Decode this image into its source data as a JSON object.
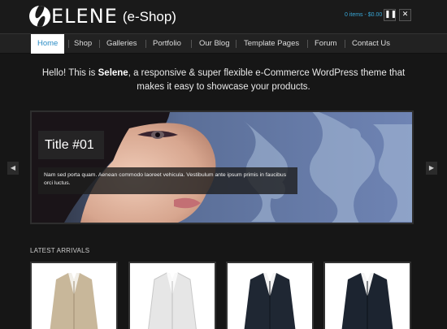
{
  "header": {
    "logo_text": "ELENE",
    "logo_subtitle": "(e-Shop)",
    "cart_text": "0 items - $0.00",
    "pause_icon": "pause-icon",
    "close_icon": "close-icon"
  },
  "nav": {
    "items": [
      {
        "label": "Home",
        "active": true
      },
      {
        "label": "Shop"
      },
      {
        "label": "Galleries"
      },
      {
        "label": "Portfolio"
      },
      {
        "label": "Our Blog"
      },
      {
        "label": "Template Pages"
      },
      {
        "label": "Forum"
      },
      {
        "label": "Contact Us"
      }
    ]
  },
  "intro": {
    "prefix": "Hello! This is ",
    "brand": "Selene",
    "line1_suffix": ", a responsive & super flexible e-Commerce WordPress theme that",
    "line2": "makes it easy to showcase your products."
  },
  "slider": {
    "title": "Title #01",
    "caption": "Nam sed porta quam. Aenean commodo laoreet vehicula. Vestibulum ante ipsum primis in faucibus orci luctus.",
    "prev_icon": "chevron-left-icon",
    "next_icon": "chevron-right-icon"
  },
  "latest": {
    "title": "LATEST ARRIVALS",
    "products": [
      {
        "name": "beige blazer",
        "color": "#c8b79a"
      },
      {
        "name": "white blazer",
        "color": "#e6e6e6"
      },
      {
        "name": "navy suit",
        "color": "#1f2733"
      },
      {
        "name": "navy suit",
        "color": "#1c2430"
      }
    ]
  },
  "colors": {
    "accent": "#39a8d8",
    "background": "#161616"
  }
}
